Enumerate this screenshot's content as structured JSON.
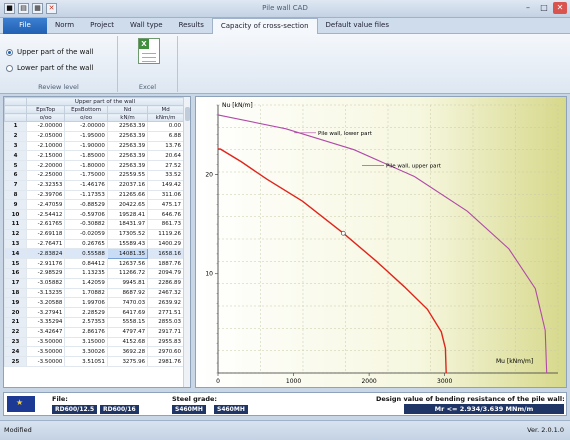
{
  "window": {
    "title": "Pile wall CAD"
  },
  "tabs": [
    {
      "label": "File"
    },
    {
      "label": "Norm"
    },
    {
      "label": "Project"
    },
    {
      "label": "Wall type"
    },
    {
      "label": "Results"
    },
    {
      "label": "Capacity of cross-section"
    },
    {
      "label": "Default value files"
    }
  ],
  "review_level": {
    "title": "Review level",
    "options": [
      {
        "label": "Upper part of the wall",
        "selected": true
      },
      {
        "label": "Lower part of the wall",
        "selected": false
      }
    ]
  },
  "excel": {
    "title": "Excel"
  },
  "table": {
    "group_header": "Upper part of the wall",
    "columns": [
      "EpsTop",
      "EpsBottom",
      "Nd",
      "Md"
    ],
    "units": [
      "o/oo",
      "o/oo",
      "kN/m",
      "kNm/m"
    ],
    "rows": [
      [
        "1",
        "-2.00000",
        "-2.00000",
        "22563.39",
        "0.00"
      ],
      [
        "2",
        "-2.05000",
        "-1.95000",
        "22563.39",
        "6.88"
      ],
      [
        "3",
        "-2.10000",
        "-1.90000",
        "22563.39",
        "13.76"
      ],
      [
        "4",
        "-2.15000",
        "-1.85000",
        "22563.39",
        "20.64"
      ],
      [
        "5",
        "-2.20000",
        "-1.80000",
        "22563.39",
        "27.52"
      ],
      [
        "6",
        "-2.25000",
        "-1.75000",
        "22559.55",
        "33.52"
      ],
      [
        "7",
        "-2.32353",
        "-1.46176",
        "22037.16",
        "149.42"
      ],
      [
        "8",
        "-2.39706",
        "-1.17353",
        "21265.66",
        "311.06"
      ],
      [
        "9",
        "-2.47059",
        "-0.88529",
        "20422.65",
        "475.17"
      ],
      [
        "10",
        "-2.54412",
        "-0.59706",
        "19528.41",
        "646.76"
      ],
      [
        "11",
        "-2.61765",
        "-0.30882",
        "18431.97",
        "861.73"
      ],
      [
        "12",
        "-2.69118",
        "-0.02059",
        "17305.52",
        "1119.26"
      ],
      [
        "13",
        "-2.76471",
        "0.26765",
        "15589.43",
        "1400.29"
      ],
      [
        "14",
        "-2.83824",
        "0.55588",
        "14081.35",
        "1658.16"
      ],
      [
        "15",
        "-2.91176",
        "0.84412",
        "12637.56",
        "1887.76"
      ],
      [
        "16",
        "-2.98529",
        "1.13235",
        "11266.72",
        "2094.79"
      ],
      [
        "17",
        "-3.05882",
        "1.42059",
        "9945.81",
        "2286.89"
      ],
      [
        "18",
        "-3.13235",
        "1.70882",
        "8687.92",
        "2467.32"
      ],
      [
        "19",
        "-3.20588",
        "1.99706",
        "7470.03",
        "2639.92"
      ],
      [
        "20",
        "-3.27941",
        "2.28529",
        "6417.69",
        "2771.51"
      ],
      [
        "21",
        "-3.35294",
        "2.57353",
        "5558.15",
        "2855.03"
      ],
      [
        "22",
        "-3.42647",
        "2.86176",
        "4797.47",
        "2917.71"
      ],
      [
        "23",
        "-3.50000",
        "3.15000",
        "4152.68",
        "2955.83"
      ],
      [
        "24",
        "-3.50000",
        "3.30026",
        "3692.28",
        "2970.60"
      ],
      [
        "25",
        "-3.50000",
        "3.51051",
        "3275.96",
        "2981.76"
      ]
    ],
    "selected_row": 14
  },
  "chart_data": {
    "type": "line",
    "xlabel": "Mu",
    "xunit": "[kNm/m]",
    "ylabel": "Nu",
    "yunit": "[kN/m]",
    "xlim": [
      0,
      4500
    ],
    "ylim": [
      0,
      27000
    ],
    "x_ticks": [
      0,
      1000,
      2000,
      3000
    ],
    "y_ticks": [
      10,
      20
    ],
    "series": [
      {
        "name": "Pile wall, lower part",
        "color": "#b04aa8",
        "points": [
          [
            0,
            26000
          ],
          [
            900,
            24600
          ],
          [
            1800,
            22500
          ],
          [
            2600,
            19800
          ],
          [
            3300,
            16300
          ],
          [
            3850,
            12500
          ],
          [
            4200,
            8500
          ],
          [
            4330,
            4300
          ],
          [
            4350,
            0
          ]
        ]
      },
      {
        "name": "Pile wall, upper part",
        "color": "#e0241b",
        "points": [
          [
            0,
            22563
          ],
          [
            33,
            22559
          ],
          [
            311,
            21266
          ],
          [
            647,
            19528
          ],
          [
            1119,
            17306
          ],
          [
            1658,
            14081
          ],
          [
            2095,
            11267
          ],
          [
            2467,
            8688
          ],
          [
            2772,
            6418
          ],
          [
            2956,
            4153
          ],
          [
            3010,
            2500
          ],
          [
            3020,
            0
          ]
        ]
      }
    ],
    "marker": [
      1658,
      14081
    ]
  },
  "info": {
    "file_label": "File:",
    "file_value_1": "RD600/12.5",
    "file_value_2": "RD600/16",
    "steel_label": "Steel grade:",
    "steel_value_1": "S460MH",
    "steel_value_2": "S460MH",
    "design_label": "Design value of bending resistance of the pile wall:",
    "design_value": "Mr <= 2.934/3.639 MNm/m"
  },
  "status": {
    "left": "Modified",
    "right": "Ver. 2.0.1.0"
  }
}
